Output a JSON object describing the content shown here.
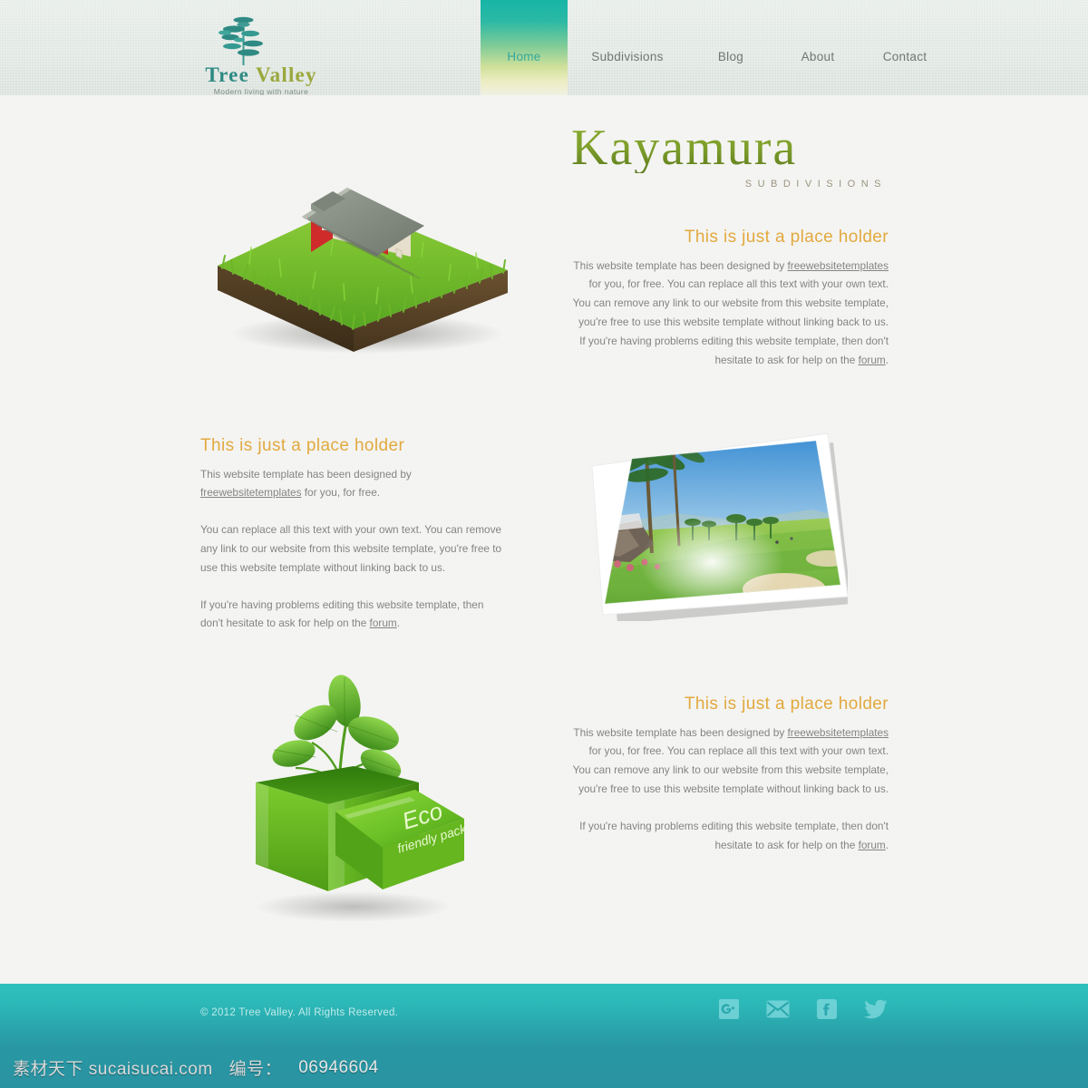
{
  "header": {
    "logo": {
      "word_primary": "Tree",
      "word_secondary": "Valley",
      "tagline": "Modern living with nature",
      "icon": "tree-icon",
      "color_primary": "#2e8a83",
      "color_secondary": "#9aa83c"
    },
    "nav": [
      {
        "label": "Home",
        "active": true
      },
      {
        "label": "Subdivisions",
        "active": false
      },
      {
        "label": "Blog",
        "active": false
      },
      {
        "label": "About",
        "active": false
      },
      {
        "label": "Contact",
        "active": false
      }
    ]
  },
  "main": {
    "brand": {
      "title": "Kayamura",
      "subtitle": "SUBDIVISIONS",
      "title_color": "#7a9e28",
      "subtitle_color": "#9a9480"
    },
    "images": {
      "house": "house-on-grass-image",
      "photo": "golf-course-photo-image",
      "eco_box": "eco-friendly-pack-box-image",
      "eco_box_label_line1": "Eco",
      "eco_box_label_line2": "friendly pack"
    },
    "blocks": [
      {
        "heading": "This is just a place holder",
        "align": "right",
        "paragraphs": [
          {
            "before": "This website template has been designed by ",
            "link": "freewebsitetemplates",
            "after": " for you, for free. You can replace all this text with your own text. You can remove any link to our website from this website template, you're free to use this website template without linking back to us. If you're having problems editing this website template, then don't hesitate to ask for help on the ",
            "link2": "forum",
            "after2": "."
          }
        ]
      },
      {
        "heading": "This is just a place holder",
        "align": "left",
        "paragraphs": [
          {
            "before": "This website template has been designed by ",
            "link": "freewebsitetemplates",
            "after": " for you, for free."
          },
          {
            "before": "You can replace all this text with your own text. You can remove any link to our website from this website template, you're free to use this website template without linking back to us."
          },
          {
            "before": "If you're having problems editing this website template, then don't hesitate to ask for help on the ",
            "link2": "forum",
            "after2": "."
          }
        ]
      },
      {
        "heading": "This is just a place holder",
        "align": "right",
        "paragraphs": [
          {
            "before": "This website template has been designed by ",
            "link": "freewebsitetemplates",
            "after": " for you, for free. You can replace all this text with your own text. You can remove any link to our website from this website template, you're free to use this website template without linking back to us."
          },
          {
            "before": "If you're having problems editing this website template, then don't hesitate to ask for help on the ",
            "link2": "forum",
            "after2": "."
          }
        ]
      }
    ]
  },
  "footer": {
    "copyright": "© 2012 Tree Valley. All Rights Reserved.",
    "background_color": "#2cb9b8",
    "social": [
      {
        "name": "google-plus-icon",
        "label": "Google+"
      },
      {
        "name": "email-icon",
        "label": "Email"
      },
      {
        "name": "facebook-icon",
        "label": "Facebook"
      },
      {
        "name": "twitter-icon",
        "label": "Twitter"
      }
    ]
  },
  "watermark": {
    "site": "素材天下 sucaisucai.com",
    "id_label": "编号：",
    "id_value": "06946604"
  }
}
